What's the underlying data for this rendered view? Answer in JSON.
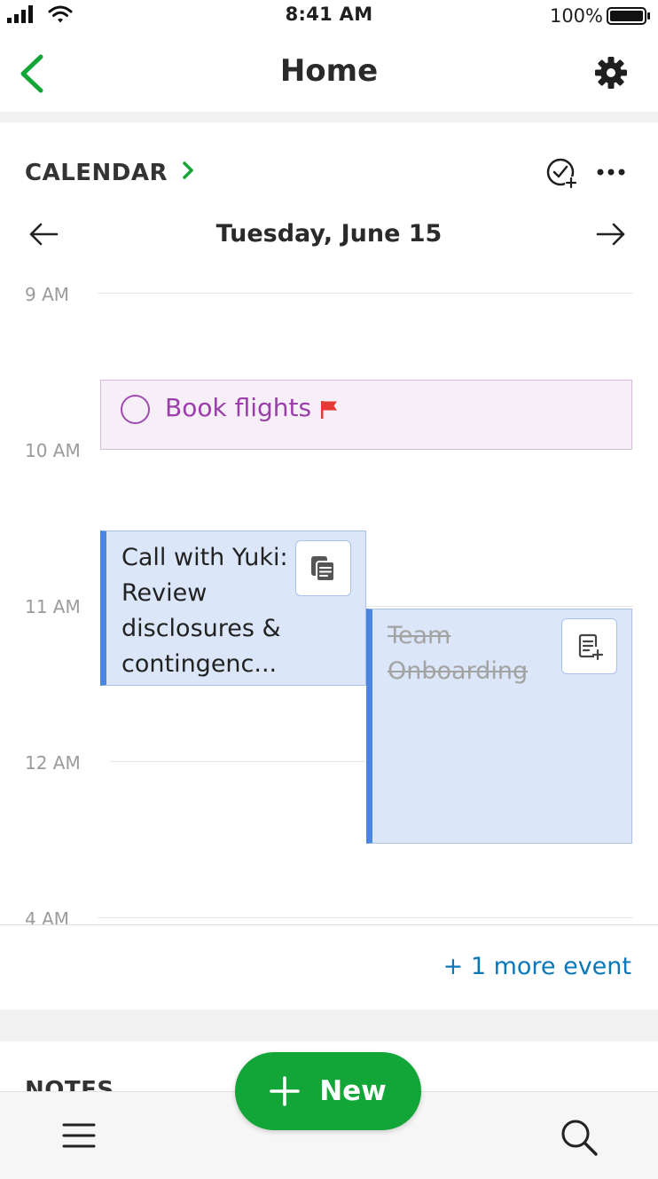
{
  "status_bar": {
    "time": "8:41 AM",
    "battery": "100%"
  },
  "nav": {
    "title": "Home",
    "back_icon": "chevron-left-icon",
    "settings_icon": "gear-icon"
  },
  "calendar": {
    "header": "CALENDAR",
    "date": "Tuesday, June 15",
    "hours": [
      "9 AM",
      "10 AM",
      "11 AM",
      "12 AM",
      "4 AM"
    ],
    "task": {
      "title": "Book flights",
      "flag_color": "#e53935"
    },
    "events": [
      {
        "title": "Call with Yuki: Review disclosures & contingenc...",
        "completed": false
      },
      {
        "title": "Team Onboarding",
        "completed": true
      }
    ],
    "more_events": "+ 1 more event"
  },
  "notes": {
    "header": "NOTES"
  },
  "new_button": {
    "label": "New"
  },
  "colors": {
    "accent_green": "#12a537",
    "event_blue": "#4a86e0",
    "task_purple": "#9b3daa",
    "link_blue": "#0a78b8"
  }
}
